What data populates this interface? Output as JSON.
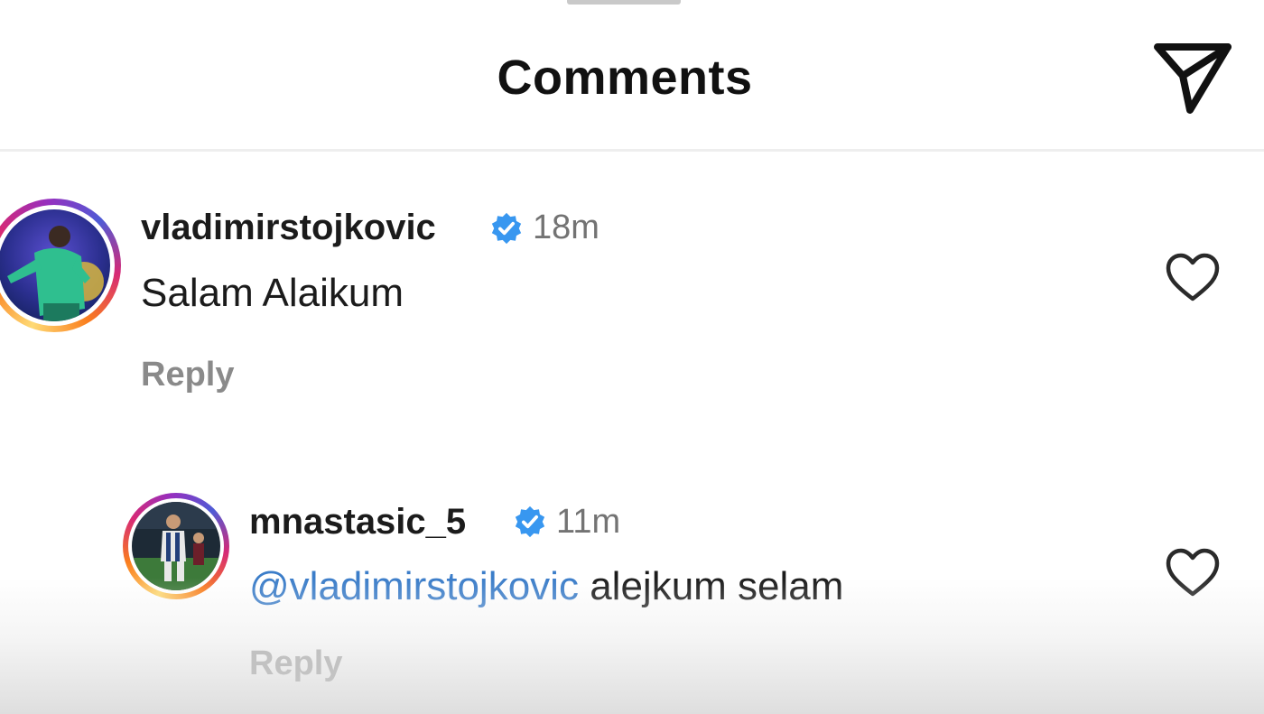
{
  "header": {
    "title": "Comments",
    "send_icon": "paper-plane-icon"
  },
  "comments": [
    {
      "username": "vladimirstojkovic",
      "verified": true,
      "time": "18m",
      "text": "Salam Alaikum",
      "reply_label": "Reply",
      "like_icon": "heart-outline-icon"
    },
    {
      "username": "mnastasic_5",
      "verified": true,
      "time": "11m",
      "mention": "@vladimirstojkovic",
      "text": "alejkum selam",
      "reply_label": "Reply",
      "like_icon": "heart-outline-icon"
    }
  ],
  "colors": {
    "verified_badge": "#3897f0",
    "mention": "#3b7dc9",
    "secondary_text": "#737373",
    "reply_text": "#8a8a8a"
  }
}
